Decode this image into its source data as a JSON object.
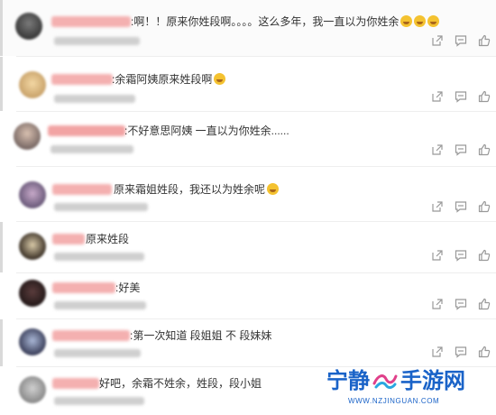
{
  "comments": [
    {
      "text": ":啊！！原来你姓段啊。。。。这么多年，我一直以为你姓余",
      "emoji_count": 3
    },
    {
      "text": ":余霜阿姨原来姓段啊",
      "emoji_count": 1
    },
    {
      "text": ":不好意思阿姨 一直以为你姓余......",
      "emoji_count": 0
    },
    {
      "text": "原来霜姐姓段，我还以为姓余呢",
      "emoji_count": 1
    },
    {
      "text": "原来姓段",
      "emoji_count": 0
    },
    {
      "text": ":好美",
      "emoji_count": 0
    },
    {
      "text": ":第一次知道 段姐姐 不 段妹妹",
      "emoji_count": 0
    },
    {
      "text": "好吧，余霜不姓余，姓段，段小姐",
      "emoji_count": 0
    }
  ],
  "icons": {
    "share": "share-icon",
    "reply": "reply-icon",
    "like": "like-icon"
  },
  "watermark": {
    "title_left": "宁静",
    "title_right": "手游网",
    "url": "WWW.NZJINGUAN.COM"
  },
  "colors": {
    "watermark": "#1a63c8",
    "name_blur": "#f2a3a3",
    "meta_blur": "#cfcfcf"
  }
}
